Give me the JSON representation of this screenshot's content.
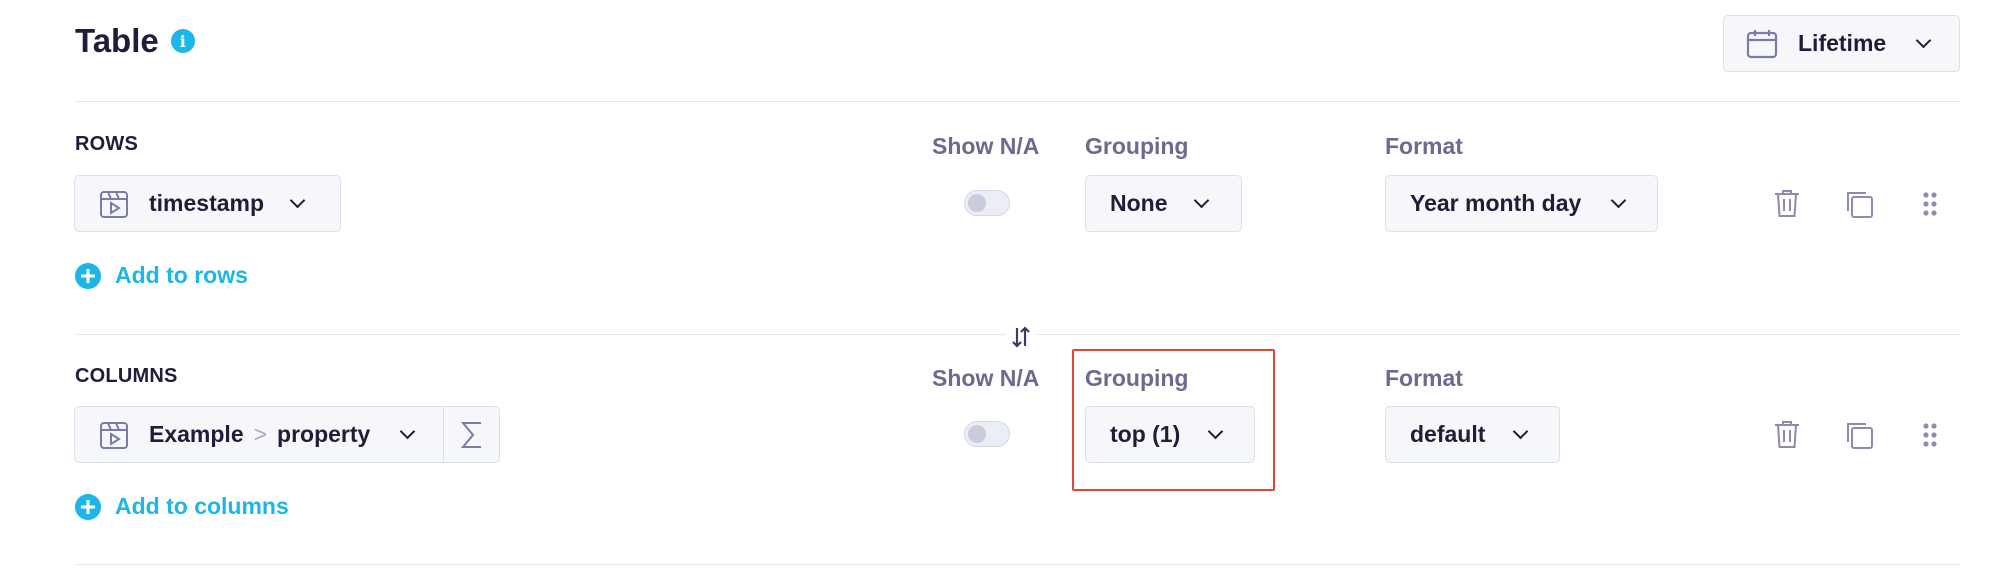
{
  "header": {
    "title": "Table",
    "info_icon": "info-icon",
    "date_range": {
      "icon": "calendar-icon",
      "label": "Lifetime"
    }
  },
  "rows": {
    "section_label": "ROWS",
    "show_na_label": "Show N/A",
    "grouping_label": "Grouping",
    "format_label": "Format",
    "property": {
      "icon": "event-source-icon",
      "name": "timestamp"
    },
    "show_na_enabled": false,
    "grouping_value": "None",
    "format_value": "Year month day",
    "add_label": "Add to rows"
  },
  "columns": {
    "section_label": "COLUMNS",
    "show_na_label": "Show N/A",
    "grouping_label": "Grouping",
    "format_label": "Format",
    "property": {
      "icon": "event-source-icon",
      "parent": "Example",
      "separator": ">",
      "name": "property"
    },
    "aggregate_icon": "sigma-icon",
    "show_na_enabled": false,
    "grouping_value": "top (1)",
    "format_value": "default",
    "add_label": "Add to columns"
  },
  "swap_icon": "swap-arrows-icon",
  "colors": {
    "accent": "#1bb7e8",
    "text": "#1f1d3a",
    "muted": "#6c6a8f",
    "highlight": "#e5463a"
  }
}
